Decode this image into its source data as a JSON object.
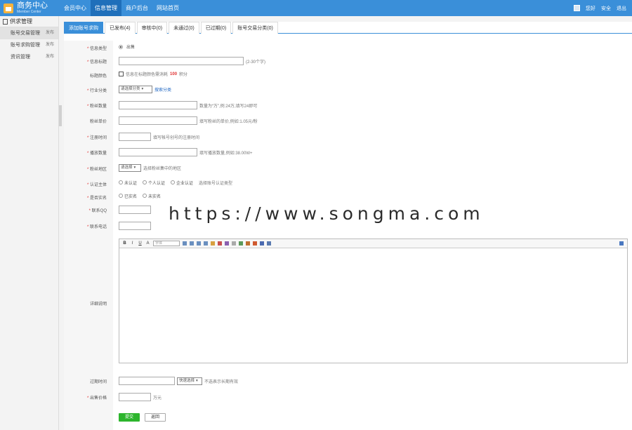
{
  "brand": {
    "title": "商务中心",
    "subtitle": "Member Center"
  },
  "topnav": [
    "会员中心",
    "信息管理",
    "商户后台",
    "网站首页"
  ],
  "topright": {
    "user": "您好",
    "settings": "安全",
    "logout": "退出"
  },
  "sidebar": {
    "head": "供求管理",
    "items": [
      {
        "label": "账号交易管理",
        "badge": "发布"
      },
      {
        "label": "账号求购管理",
        "badge": "发布"
      },
      {
        "label": "资讯管理",
        "badge": "发布"
      }
    ]
  },
  "tabs": [
    "添加账号求购",
    "已发布(4)",
    "审核中(0)",
    "未通过(0)",
    "已过期(0)",
    "账号交易分类(0)"
  ],
  "form": {
    "info_type": {
      "label": "信息类型",
      "option": "出售"
    },
    "title": {
      "label": "信息标题",
      "hint": "(2-30个字)"
    },
    "title_color": {
      "label": "标题颜色",
      "hint": "信息在标题颜色需消耗",
      "points": "100",
      "unit": "积分"
    },
    "category": {
      "label": "行业分类",
      "select": "请选择分类",
      "link": "搜索分类"
    },
    "fans": {
      "label": "粉丝数量",
      "hint": "数量为“万”,例:24万,填写24即可"
    },
    "fan_price": {
      "label": "粉丝单价",
      "hint": "填写粉丝的单价,例如:1.05元/粉"
    },
    "reg_time": {
      "label": "注册时间",
      "hint": "填写帐号创号的注册时间"
    },
    "plays": {
      "label": "播放数量",
      "hint": "填写播放数量,例如:38.00W+"
    },
    "region": {
      "label": "粉丝地区",
      "select": "请选择",
      "hint": "选择粉丝集中的地区"
    },
    "auth": {
      "label": "认证主体",
      "options": [
        "未认证",
        "个人认证",
        "企业认证"
      ],
      "hint": "选择账号认证类型"
    },
    "realname": {
      "label": "是否实名",
      "options": [
        "已实名",
        "未实名"
      ]
    },
    "qq": {
      "label": "联系QQ"
    },
    "phone": {
      "label": "联系电话"
    },
    "detail": {
      "label": "详细说明",
      "font_select": "字体"
    },
    "expire": {
      "label": "过期时间",
      "select": "快速选择",
      "hint": "不选表示长期有效"
    },
    "price": {
      "label": "出售价格",
      "unit": "万元"
    },
    "submit": "提交",
    "reset": "返回"
  },
  "watermark": "https://www.songma.com",
  "colors": {
    "topbar": "#3a8fd9",
    "active": "#1f6fba",
    "submit": "#2db52d"
  }
}
